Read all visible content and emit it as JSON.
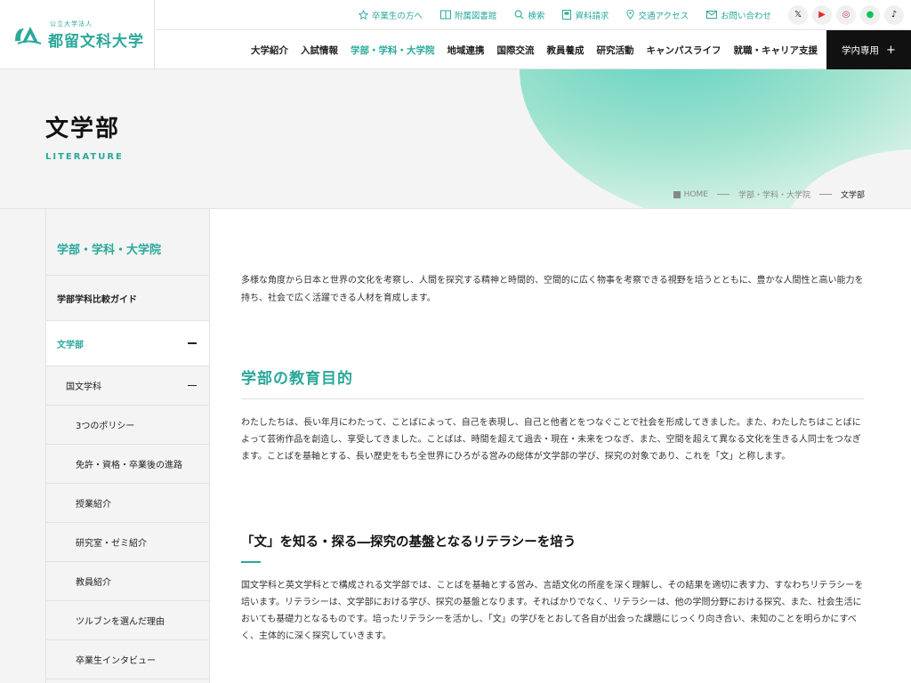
{
  "logo": {
    "sub": "公立大学法人",
    "name": "都留文科大学"
  },
  "util_links": [
    {
      "label": "卒業生の方へ",
      "icon": "star-icon"
    },
    {
      "label": "附属図書館",
      "icon": "book-icon"
    },
    {
      "label": "検索",
      "icon": "search-icon"
    },
    {
      "label": "資料請求",
      "icon": "document-icon"
    },
    {
      "label": "交通アクセス",
      "icon": "map-pin-icon"
    },
    {
      "label": "お問い合わせ",
      "icon": "mail-icon"
    }
  ],
  "sns": [
    {
      "label": "𝕏",
      "icon": "x-icon",
      "color": "#111111"
    },
    {
      "label": "▶",
      "icon": "youtube-icon",
      "color": "#e52d27"
    },
    {
      "label": "◎",
      "icon": "instagram-icon",
      "color": "#c13584"
    },
    {
      "label": "●",
      "icon": "line-icon",
      "color": "#06c755"
    },
    {
      "label": "♪",
      "icon": "tiktok-icon",
      "color": "#111111"
    }
  ],
  "nav": [
    {
      "label": "大学紹介"
    },
    {
      "label": "入試情報"
    },
    {
      "label": "学部・学科・大学院",
      "active": true
    },
    {
      "label": "地域連携"
    },
    {
      "label": "国際交流"
    },
    {
      "label": "教員養成"
    },
    {
      "label": "研究活動"
    },
    {
      "label": "キャンパスライフ"
    },
    {
      "label": "就職・キャリア支援"
    }
  ],
  "internal_button": {
    "label": "学内専用",
    "plus": "+"
  },
  "hero": {
    "title": "文学部",
    "subtitle": "LITERATURE"
  },
  "breadcrumb": {
    "home": "HOME",
    "parent": "学部・学科・大学院",
    "current": "文学部"
  },
  "sidebar": {
    "heading": "学部・学科・大学院",
    "guide": "学部学科比較ガイド",
    "faculty": "文学部",
    "department": "国文学科",
    "sub_items": [
      "3つのポリシー",
      "免許・資格・卒業後の進路",
      "授業紹介",
      "研究室・ゼミ紹介",
      "教員紹介",
      "ツルブンを選んだ理由",
      "卒業生インタビュー"
    ]
  },
  "content": {
    "intro": "多様な角度から日本と世界の文化を考察し、人間を探究する精神と時間的、空間的に広く物事を考察できる視野を培うとともに、豊かな人間性と高い能力を持ち、社会で広く活躍できる人材を育成します。",
    "h2": "学部の教育目的",
    "para1": "わたしたちは、長い年月にわたって、ことばによって、自己を表現し、自己と他者とをつなぐことで社会を形成してきました。また、わたしたちはことばによって芸術作品を創造し、享受してきました。ことばは、時間を超えて過去・現在・未来をつなぎ、また、空間を超えて異なる文化を生きる人同士をつなぎます。ことばを基軸とする、長い歴史をもち全世界にひろがる営みの総体が文学部の学び、探究の対象であり、これを「文」と称します。",
    "h3": "「文」を知る・探る―探究の基盤となるリテラシーを培う",
    "para2": "国文学科と英文学科とで構成される文学部では、ことばを基軸とする営み、言語文化の所産を深く理解し、その結果を適切に表す力、すなわちリテラシーを培います。リテラシーは、文学部における学び、探究の基盤となります。そればかりでなく、リテラシーは、他の学問分野における探究、また、社会生活においても基礎力となるものです。培ったリテラシーを活かし、「文」の学びをとおして各自が出会った課題にじっくり向き合い、未知のことを明らかにすべく、主体的に深く探究していきます。"
  },
  "colors": {
    "accent": "#2aa89a",
    "dark": "#111111"
  }
}
